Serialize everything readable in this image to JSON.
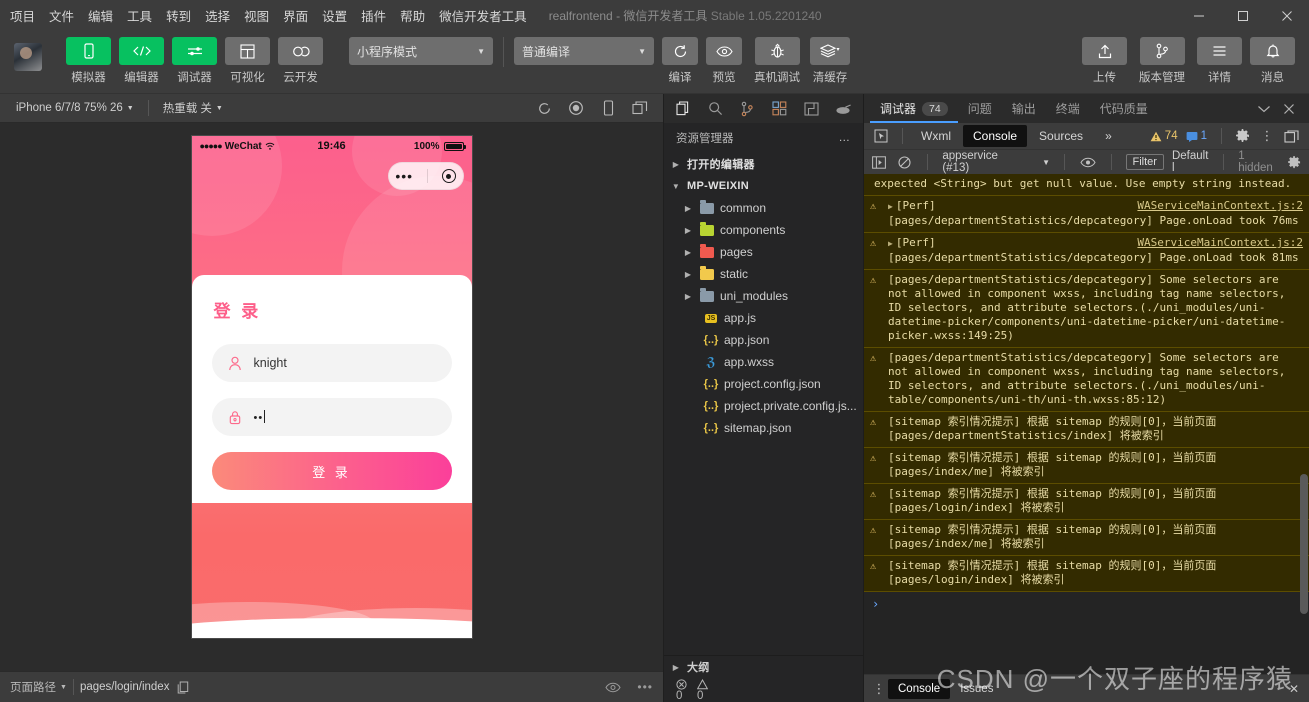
{
  "titlebar": {
    "menus": [
      "项目",
      "文件",
      "编辑",
      "工具",
      "转到",
      "选择",
      "视图",
      "界面",
      "设置",
      "插件",
      "帮助",
      "微信开发者工具"
    ],
    "project_name": "realfrontend",
    "separator": "-",
    "app_name": "微信开发者工具",
    "version": "Stable 1.05.2201240",
    "minimize": "–",
    "maximize": "□",
    "close": "✕"
  },
  "toolbar": {
    "left_items": [
      {
        "label": "模拟器",
        "icon": "phone-icon",
        "style": "green"
      },
      {
        "label": "编辑器",
        "icon": "code-icon",
        "style": "green"
      },
      {
        "label": "调试器",
        "icon": "sliders-icon",
        "style": "green"
      },
      {
        "label": "可视化",
        "icon": "layout-icon",
        "style": "grey"
      },
      {
        "label": "云开发",
        "icon": "cloud-icon",
        "style": "grey"
      }
    ],
    "mode_select": "小程序模式",
    "compile_select": "普通编译",
    "mid_items": [
      {
        "label": "编译",
        "icon": "refresh-icon"
      },
      {
        "label": "预览",
        "icon": "eye-icon"
      },
      {
        "label": "真机调试",
        "icon": "bug-icon"
      },
      {
        "label": "清缓存",
        "icon": "layers-icon"
      }
    ],
    "right_items": [
      {
        "label": "上传",
        "icon": "upload-icon"
      },
      {
        "label": "版本管理",
        "icon": "branch-icon"
      },
      {
        "label": "详情",
        "icon": "menu-icon"
      },
      {
        "label": "消息",
        "icon": "bell-icon"
      }
    ]
  },
  "simulator": {
    "device": "iPhone 6/7/8 75% 26",
    "hot_reload": "热重载 关",
    "icons": [
      "rotate-icon",
      "record-icon",
      "phone-icon",
      "windows-icon"
    ],
    "screen": {
      "carrier": "WeChat",
      "dots": "●●●●●",
      "time": "19:46",
      "battery_pct": "100%",
      "capsule_dots": "•••",
      "card_title": "登 录",
      "username_value": "knight",
      "username_icon": "user-icon",
      "password_value": "••",
      "password_icon": "lock-icon",
      "login_button": "登 录"
    },
    "status": {
      "path_label": "页面路径",
      "path_value": "pages/login/index",
      "copy_icon": "copy-icon",
      "eye_icon": "eye-icon",
      "more_icon": "more-icon"
    }
  },
  "explorer": {
    "activity_icons": [
      "files-icon",
      "search-icon",
      "source-control-icon",
      "extensions-icon",
      "debug-icon",
      "cloud-icon"
    ],
    "header": "资源管理器",
    "header_more": "…",
    "sections": [
      {
        "label": "打开的编辑器",
        "expanded": false
      },
      {
        "label": "MP-WEIXIN",
        "expanded": true
      }
    ],
    "items": [
      {
        "label": "common",
        "type": "folder",
        "color": "#8a9aa8"
      },
      {
        "label": "components",
        "type": "folder",
        "color": "#b8d432"
      },
      {
        "label": "pages",
        "type": "folder",
        "color": "#f05a4f"
      },
      {
        "label": "static",
        "type": "folder",
        "color": "#f2c94c"
      },
      {
        "label": "uni_modules",
        "type": "folder",
        "color": "#8a9aa8"
      },
      {
        "label": "app.js",
        "type": "js"
      },
      {
        "label": "app.json",
        "type": "json"
      },
      {
        "label": "app.wxss",
        "type": "css"
      },
      {
        "label": "project.config.json",
        "type": "json"
      },
      {
        "label": "project.private.config.js...",
        "type": "json"
      },
      {
        "label": "sitemap.json",
        "type": "json"
      }
    ],
    "outline": "大纲",
    "problems": {
      "errors": "0",
      "warnings": "0"
    }
  },
  "devtools": {
    "tabs": [
      {
        "label": "调试器",
        "count": "74",
        "active": true
      },
      {
        "label": "问题",
        "active": false
      },
      {
        "label": "输出",
        "active": false
      },
      {
        "label": "终端",
        "active": false
      },
      {
        "label": "代码质量",
        "active": false
      }
    ],
    "chevron_icon": "chevron-down-icon",
    "close_icon": "close-icon",
    "panels": [
      {
        "label": "Wxml",
        "active": false
      },
      {
        "label": "Console",
        "active": true
      },
      {
        "label": "Sources",
        "active": false
      },
      {
        "label": "»",
        "active": false
      }
    ],
    "inspect_icon": "inspect-icon",
    "warning_count": "74",
    "info_count": "1",
    "settings_icon": "gear-icon",
    "kebab_icon": "more-vertical-icon",
    "dock_icon": "dock-icon",
    "filter_bar": {
      "play_icon": "sidebar-icon",
      "clear_icon": "clear-icon",
      "context": "appservice (#13)",
      "eye_icon": "eye-icon",
      "filter_placeholder": "Filter",
      "level": "Default l",
      "hidden": "1 hidden",
      "settings_icon": "gear-icon"
    },
    "messages": [
      {
        "level": "warn",
        "text": "expected <String> but get null value. Use empty string instead.",
        "source": "",
        "first": true,
        "no_icon": true
      },
      {
        "level": "warn",
        "tag": "[Perf]",
        "text": "[pages/departmentStatistics/depcategory] Page.onLoad took 76ms",
        "source": "WAServiceMainContext.js:2",
        "expandable": true
      },
      {
        "level": "warn",
        "tag": "[Perf]",
        "text": "[pages/departmentStatistics/depcategory] Page.onLoad took 81ms",
        "source": "WAServiceMainContext.js:2",
        "expandable": true
      },
      {
        "level": "warn",
        "text": "[pages/departmentStatistics/depcategory] Some selectors are not allowed in component wxss, including tag name selectors, ID selectors, and attribute selectors.(./uni_modules/uni-datetime-picker/components/uni-datetime-picker/uni-datetime-picker.wxss:149:25)",
        "link_from": "./uni_mo",
        "source": ""
      },
      {
        "level": "warn",
        "text": "[pages/departmentStatistics/depcategory] Some selectors are not allowed in component wxss, including tag name selectors, ID selectors, and attribute selectors.(./uni_modules/uni-table/components/uni-th/uni-th.wxss:85:12)",
        "source": ""
      },
      {
        "level": "warn",
        "text": "[sitemap 索引情况提示] 根据 sitemap 的规则[0]，当前页面 [pages/departmentStatistics/index] 将被索引",
        "source": ""
      },
      {
        "level": "warn",
        "text": "[sitemap 索引情况提示] 根据 sitemap 的规则[0]，当前页面 [pages/index/me] 将被索引",
        "source": ""
      },
      {
        "level": "warn",
        "text": "[sitemap 索引情况提示] 根据 sitemap 的规则[0]，当前页面 [pages/login/index] 将被索引",
        "source": ""
      },
      {
        "level": "warn",
        "text": "[sitemap 索引情况提示] 根据 sitemap 的规则[0]，当前页面 [pages/index/me] 将被索引",
        "source": ""
      },
      {
        "level": "warn",
        "text": "[sitemap 索引情况提示] 根据 sitemap 的规则[0]，当前页面 [pages/login/index] 将被索引",
        "source": ""
      }
    ],
    "prompt": "›",
    "footer_tabs": [
      {
        "label": "Console",
        "active": true
      },
      {
        "label": "Issues",
        "active": false
      }
    ],
    "footer_close": "✕"
  },
  "watermark": "CSDN @一个双子座的程序猿",
  "colors": {
    "accent_green": "#07c160",
    "accent_blue": "#4a9eff",
    "warn_bg": "#332b00",
    "warn_border": "#5c4d00",
    "pink": "#fc5f8d",
    "coral": "#fa6a6a"
  }
}
